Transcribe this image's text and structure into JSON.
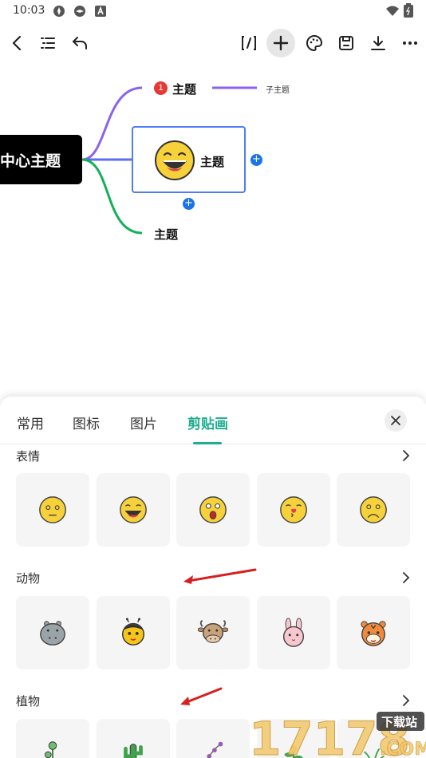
{
  "status_bar": {
    "time": "10:03"
  },
  "mindmap": {
    "center_topic": "中心主题",
    "topic_top": "主题",
    "topic_top_badge": "1",
    "subtopic": "子主题",
    "topic_selected": "主题",
    "topic_bottom": "主题",
    "add_symbol": "+"
  },
  "sheet": {
    "tabs": [
      "常用",
      "图标",
      "图片",
      "剪贴画"
    ],
    "active_tab": "剪贴画",
    "categories": [
      {
        "title": "表情",
        "items": [
          "neutral-face",
          "grin-face",
          "surprised-face",
          "kiss-face",
          "sad-face"
        ]
      },
      {
        "title": "动物",
        "items": [
          "hippo",
          "bee",
          "cow",
          "rabbit",
          "tiger"
        ]
      },
      {
        "title": "植物",
        "items": [
          "flower-plant",
          "cactus",
          "orchid",
          "plant-4",
          "plant-5"
        ]
      }
    ]
  },
  "watermark": {
    "text": "17178",
    "subtext": "下载站",
    "domain": ".COM"
  },
  "colors": {
    "accent": "#1fae8f",
    "branch_purple": "#8a63ee",
    "branch_blue": "#5b6ff0",
    "branch_green": "#13b05a",
    "select_blue": "#4f7cf7",
    "add_blue": "#1a73e8"
  }
}
